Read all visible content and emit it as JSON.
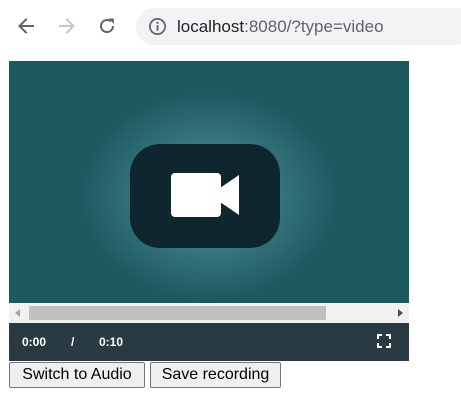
{
  "browser": {
    "url_host": "localhost",
    "url_rest": ":8080/?type=video",
    "icons": {
      "back": "arrow-left-icon",
      "forward": "arrow-right-icon",
      "reload": "reload-icon",
      "site_info": "info-icon"
    }
  },
  "player": {
    "placeholder_icon": "video-camera-icon",
    "current_time": "0:00",
    "separator": "/",
    "duration": "0:10",
    "fullscreen_icon": "fullscreen-icon",
    "colors": {
      "video_bg": "#1d5a60",
      "control_bar": "#2a3a42",
      "icon_box": "#10262f"
    }
  },
  "actions": {
    "switch_label": "Switch to Audio",
    "save_label": "Save recording"
  }
}
